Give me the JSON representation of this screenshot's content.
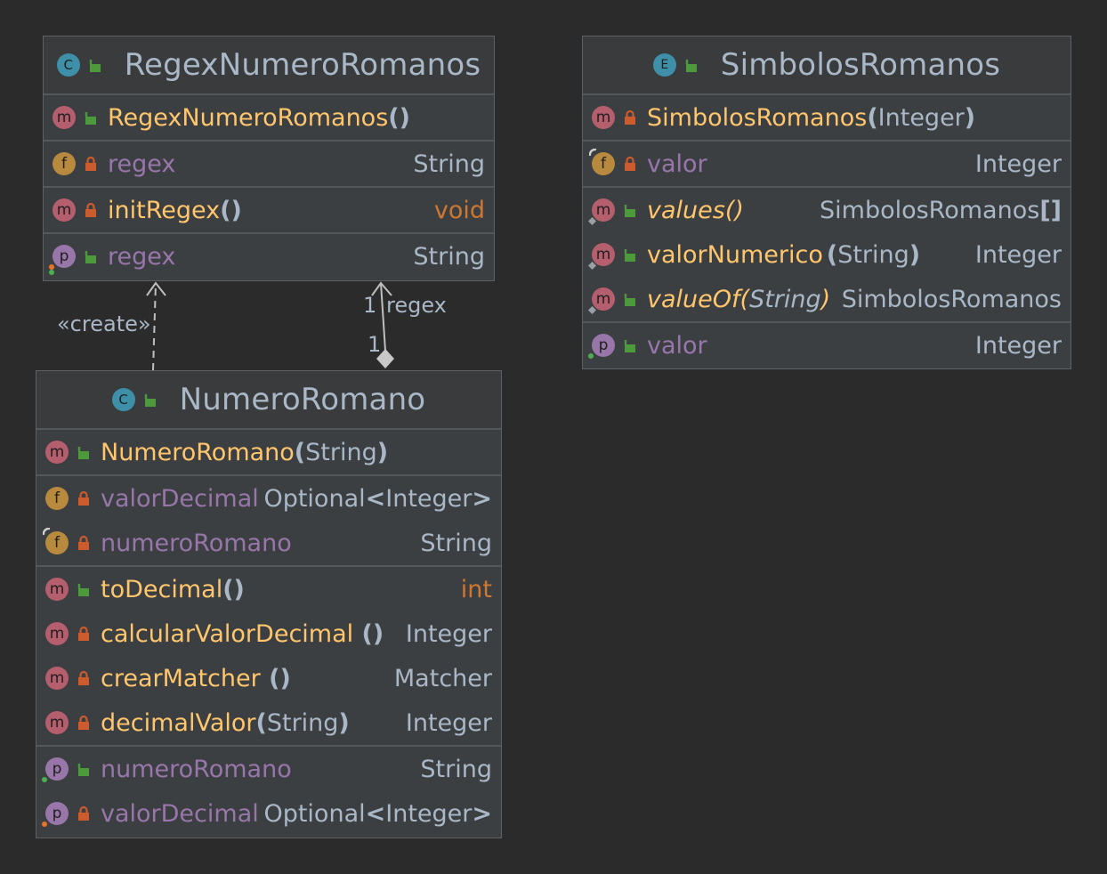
{
  "classes": {
    "regex": {
      "title": "RegexNumeroRomanos",
      "kind": "C",
      "constructor": {
        "name": "RegexNumeroRomanos",
        "open": "(",
        "close": ")",
        "args": ""
      },
      "field_regex": {
        "name": "regex",
        "type": "String"
      },
      "method_init": {
        "name": "initRegex",
        "parens": "()",
        "type": "void"
      },
      "prop_regex": {
        "name": "regex",
        "type": "String"
      }
    },
    "simbolos": {
      "title": "SimbolosRomanos",
      "kind": "E",
      "constructor": {
        "name": "SimbolosRomanos",
        "open": "(",
        "args": "Integer",
        "close": ")"
      },
      "field_valor": {
        "name": "valor",
        "type": "Integer"
      },
      "method_values": {
        "name": "values",
        "parens": "()",
        "type_main": "SimbolosRomanos",
        "type_suffix": "[]"
      },
      "method_valorNumerico": {
        "name": "valorNumerico",
        "open": "(",
        "args": "String",
        "close": ")",
        "type": "Integer"
      },
      "method_valueOf": {
        "name": "valueOf",
        "open": "(",
        "args": "String",
        "close": ")",
        "type": "SimbolosRomanos"
      },
      "prop_valor": {
        "name": "valor",
        "type": "Integer"
      }
    },
    "numero": {
      "title": "NumeroRomano",
      "kind": "C",
      "constructor": {
        "name": "NumeroRomano",
        "open": "(",
        "args": "String",
        "close": ")"
      },
      "field_valorDecimal": {
        "name": "valorDecimal",
        "type_a": "Optional",
        "type_lt": "<",
        "type_b": "Integer",
        "type_gt": ">"
      },
      "field_numeroRomano": {
        "name": "numeroRomano",
        "type": "String"
      },
      "method_toDecimal": {
        "name": "toDecimal",
        "parens": "()",
        "type": "int"
      },
      "method_calcular": {
        "name": "calcularValorDecimal",
        "parens": " ()",
        "type": "Integer"
      },
      "method_crear": {
        "name": "crearMatcher",
        "parens": " ()",
        "type": "Matcher"
      },
      "method_decimalValor": {
        "name": "decimalValor",
        "open": "(",
        "args": "String",
        "close": ")",
        "type": "Integer"
      },
      "prop_numeroRomano": {
        "name": "numeroRomano",
        "type": "String"
      },
      "prop_valorDecimal": {
        "name": "valorDecimal",
        "type_a": "Optional",
        "type_lt": "<",
        "type_b": "Integer",
        "type_gt": ">"
      }
    }
  },
  "edges": {
    "create_label": "«create»",
    "assoc_mult_target": "1",
    "assoc_role": "regex",
    "assoc_mult_source": "1"
  },
  "colors": {
    "background": "#2b2b2b",
    "box": "#3c3f41",
    "method": "#ffc66d",
    "field": "#9876aa",
    "keyword": "#cc7832",
    "badge_method": "#b55e6d",
    "badge_field": "#b88a3e",
    "badge_property": "#9876aa",
    "badge_class": "#3e8fa8",
    "lock_private": "#cc5b2e",
    "lock_public": "#4c9a3b"
  }
}
